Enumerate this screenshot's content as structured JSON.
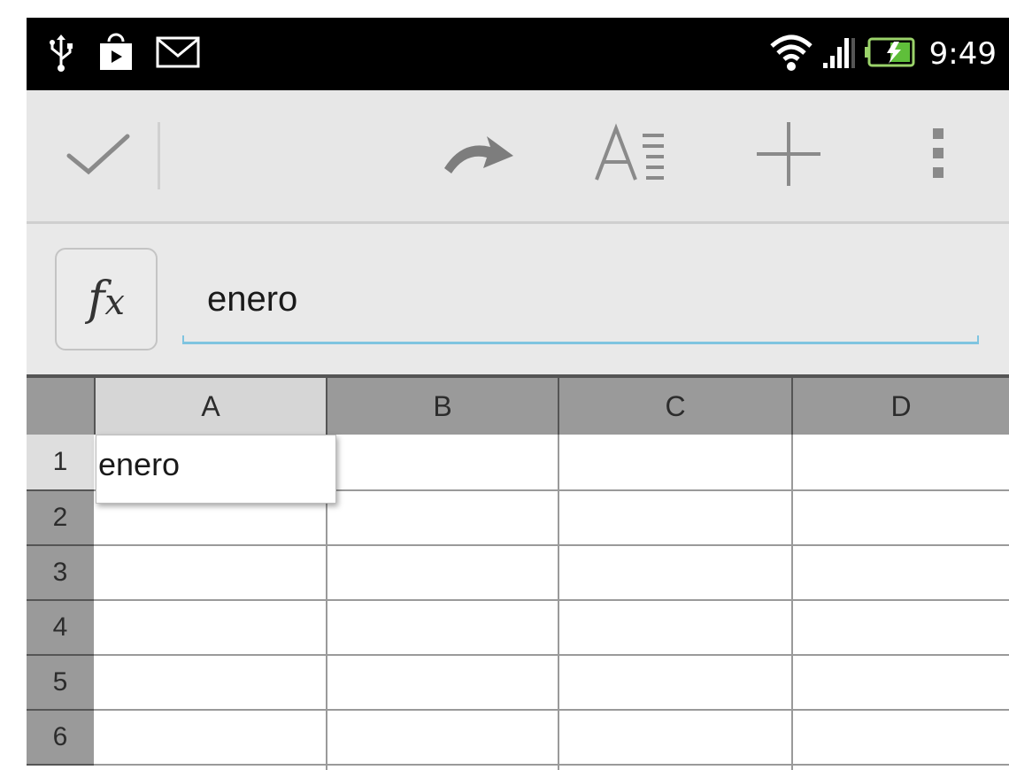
{
  "status_bar": {
    "time": "9:49",
    "left_icons": [
      "usb-icon",
      "play-store-icon",
      "mail-icon"
    ],
    "right_icons": [
      "wifi-icon",
      "signal-icon",
      "battery-charging-icon"
    ]
  },
  "action_bar": {
    "icons": [
      "checkmark-icon",
      "redo-icon",
      "text-format-icon",
      "add-icon",
      "overflow-menu-icon"
    ]
  },
  "formula_bar": {
    "fx_label": "f",
    "fx_sub": "x",
    "value": "enero"
  },
  "sheet": {
    "columns": [
      "A",
      "B",
      "C",
      "D"
    ],
    "rows": [
      "1",
      "2",
      "3",
      "4",
      "5",
      "6"
    ],
    "active_cell": {
      "ref": "A1",
      "value": "enero"
    }
  },
  "colors": {
    "status_bar": "#000000",
    "toolbar": "#e7e7e7",
    "header": "#9a9a9a",
    "accent_underline": "#7fc4e0"
  }
}
